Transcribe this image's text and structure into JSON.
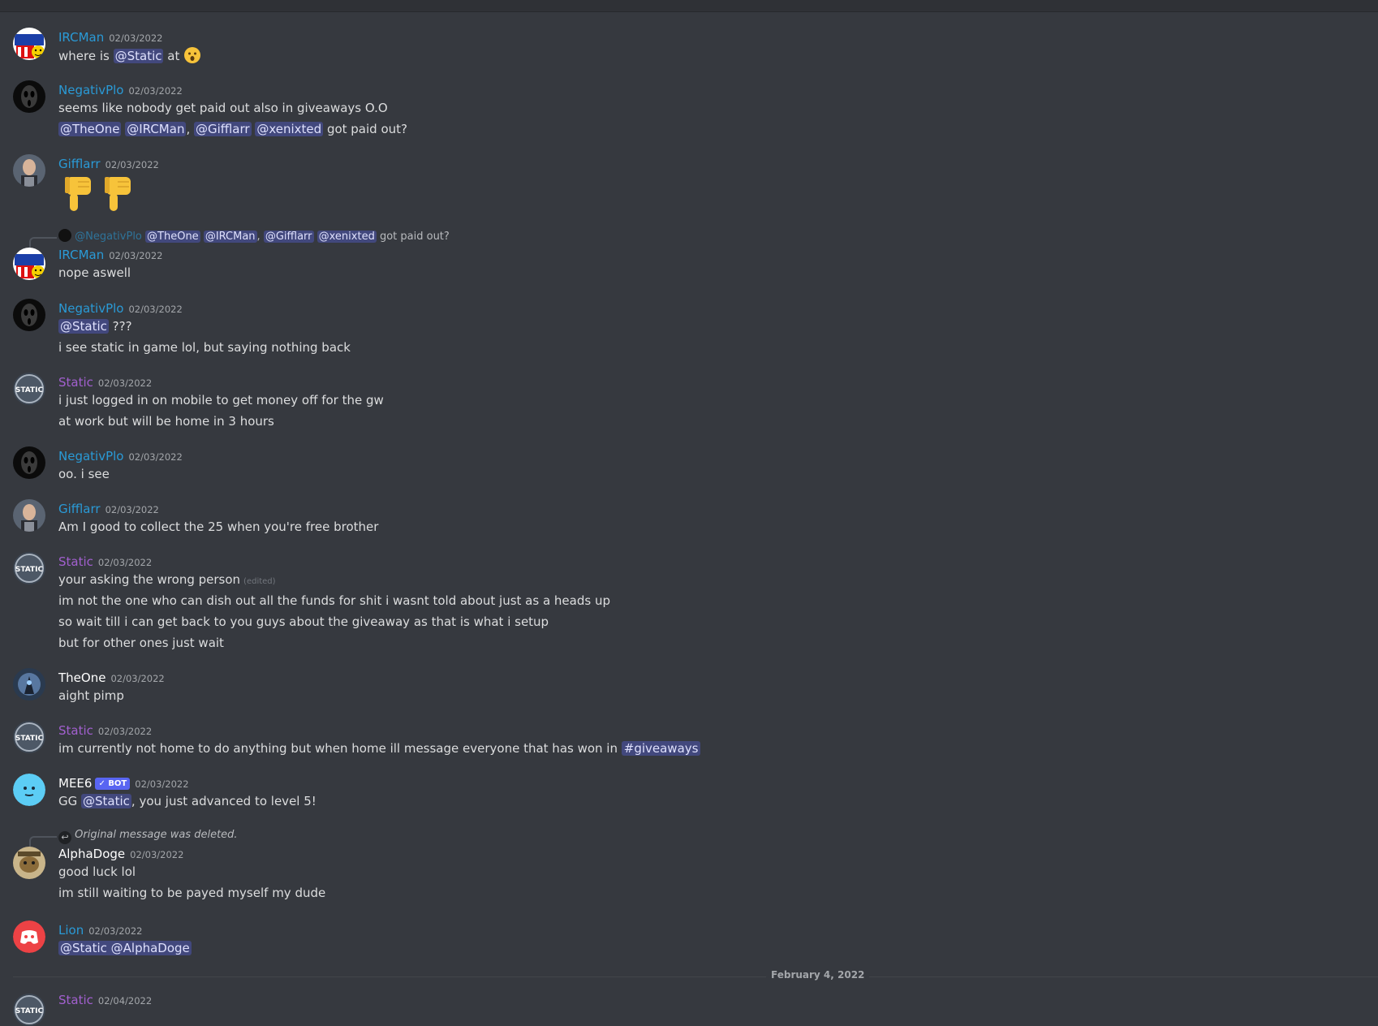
{
  "colors": {
    "background": "#36393f",
    "blue_name": "#2a9ad6",
    "purple_name": "#a260cf",
    "white_name": "#ffffff",
    "mention_bg": "#4a4f9a"
  },
  "messages": [
    {
      "author": "IRCMan",
      "color": "#2a9ad6",
      "timestamp": "02/03/2022",
      "avatar": "ircman-avatar",
      "lines": [
        [
          "where is ",
          "@Static",
          " at ",
          "open-mouth-emoji"
        ]
      ]
    },
    {
      "author": "NegativPlo",
      "color": "#2a9ad6",
      "timestamp": "02/03/2022",
      "line1": "seems like nobody get paid out also in giveaways O.O",
      "mentions": [
        "@TheOne",
        "@IRCMan",
        ", ",
        "@Gifflarr",
        "@xenixted"
      ],
      "tail": " got paid out?"
    },
    {
      "author": "Gifflarr",
      "color": "#2a9ad6",
      "timestamp": "02/03/2022",
      "emojis": "thumbs-down thumbs-down"
    },
    {
      "reply_to": "@NegativPlo",
      "reply_mentions": [
        "@TheOne",
        "@IRCMan",
        "@Gifflarr",
        "@xenixted"
      ],
      "reply_tail": " got paid out?",
      "author": "IRCMan",
      "color": "#2a9ad6",
      "timestamp": "02/03/2022",
      "text": "nope aswell"
    },
    {
      "author": "NegativPlo",
      "color": "#2a9ad6",
      "timestamp": "02/03/2022",
      "mention": "@Static",
      "after": " ???",
      "line2": "i see static in game lol, but saying nothing back"
    },
    {
      "author": "Static",
      "color": "#a260cf",
      "timestamp": "02/03/2022",
      "line1": "i just logged in on mobile to get money off for the gw",
      "line2": "at work but will be home in 3 hours"
    },
    {
      "author": "NegativPlo",
      "color": "#2a9ad6",
      "timestamp": "02/03/2022",
      "text": "oo. i see"
    },
    {
      "author": "Gifflarr",
      "color": "#2a9ad6",
      "timestamp": "02/03/2022",
      "text": "Am I good to collect the 25 when you're free brother"
    },
    {
      "author": "Static",
      "color": "#a260cf",
      "timestamp": "02/03/2022",
      "line1": "your asking the wrong person",
      "edited": "(edited)",
      "line2": "im not the one who can dish out all the funds for shit i wasnt told about just as a heads up",
      "line3": "so wait till i can get back to you guys about the giveaway as that is what i setup",
      "line4": "but for other ones just wait"
    },
    {
      "author": "TheOne",
      "color": "#ffffff",
      "timestamp": "02/03/2022",
      "text": "aight pimp"
    },
    {
      "author": "Static",
      "color": "#a260cf",
      "timestamp": "02/03/2022",
      "text": "im currently not home to do anything but when home ill message everyone that has won in ",
      "channel": "#giveaways"
    },
    {
      "author": "MEE6",
      "color": "#ffffff",
      "badge": "✓ BOT",
      "timestamp": "02/03/2022",
      "pre": "GG ",
      "mention": "@Static",
      "post": ", you just advanced to level 5!"
    },
    {
      "reply_text": "Original message was deleted.",
      "author": "AlphaDoge",
      "color": "#ffffff",
      "timestamp": "02/03/2022",
      "line1": "good luck lol",
      "line2": "im still waiting to be payed myself my dude"
    },
    {
      "author": "Lion",
      "color": "#2a9ad6",
      "timestamp": "02/03/2022",
      "mention": "@Static @AlphaDoge"
    },
    {
      "author": "Static",
      "color": "#a260cf",
      "timestamp": "02/04/2022"
    }
  ],
  "divider_label": "February 4, 2022"
}
